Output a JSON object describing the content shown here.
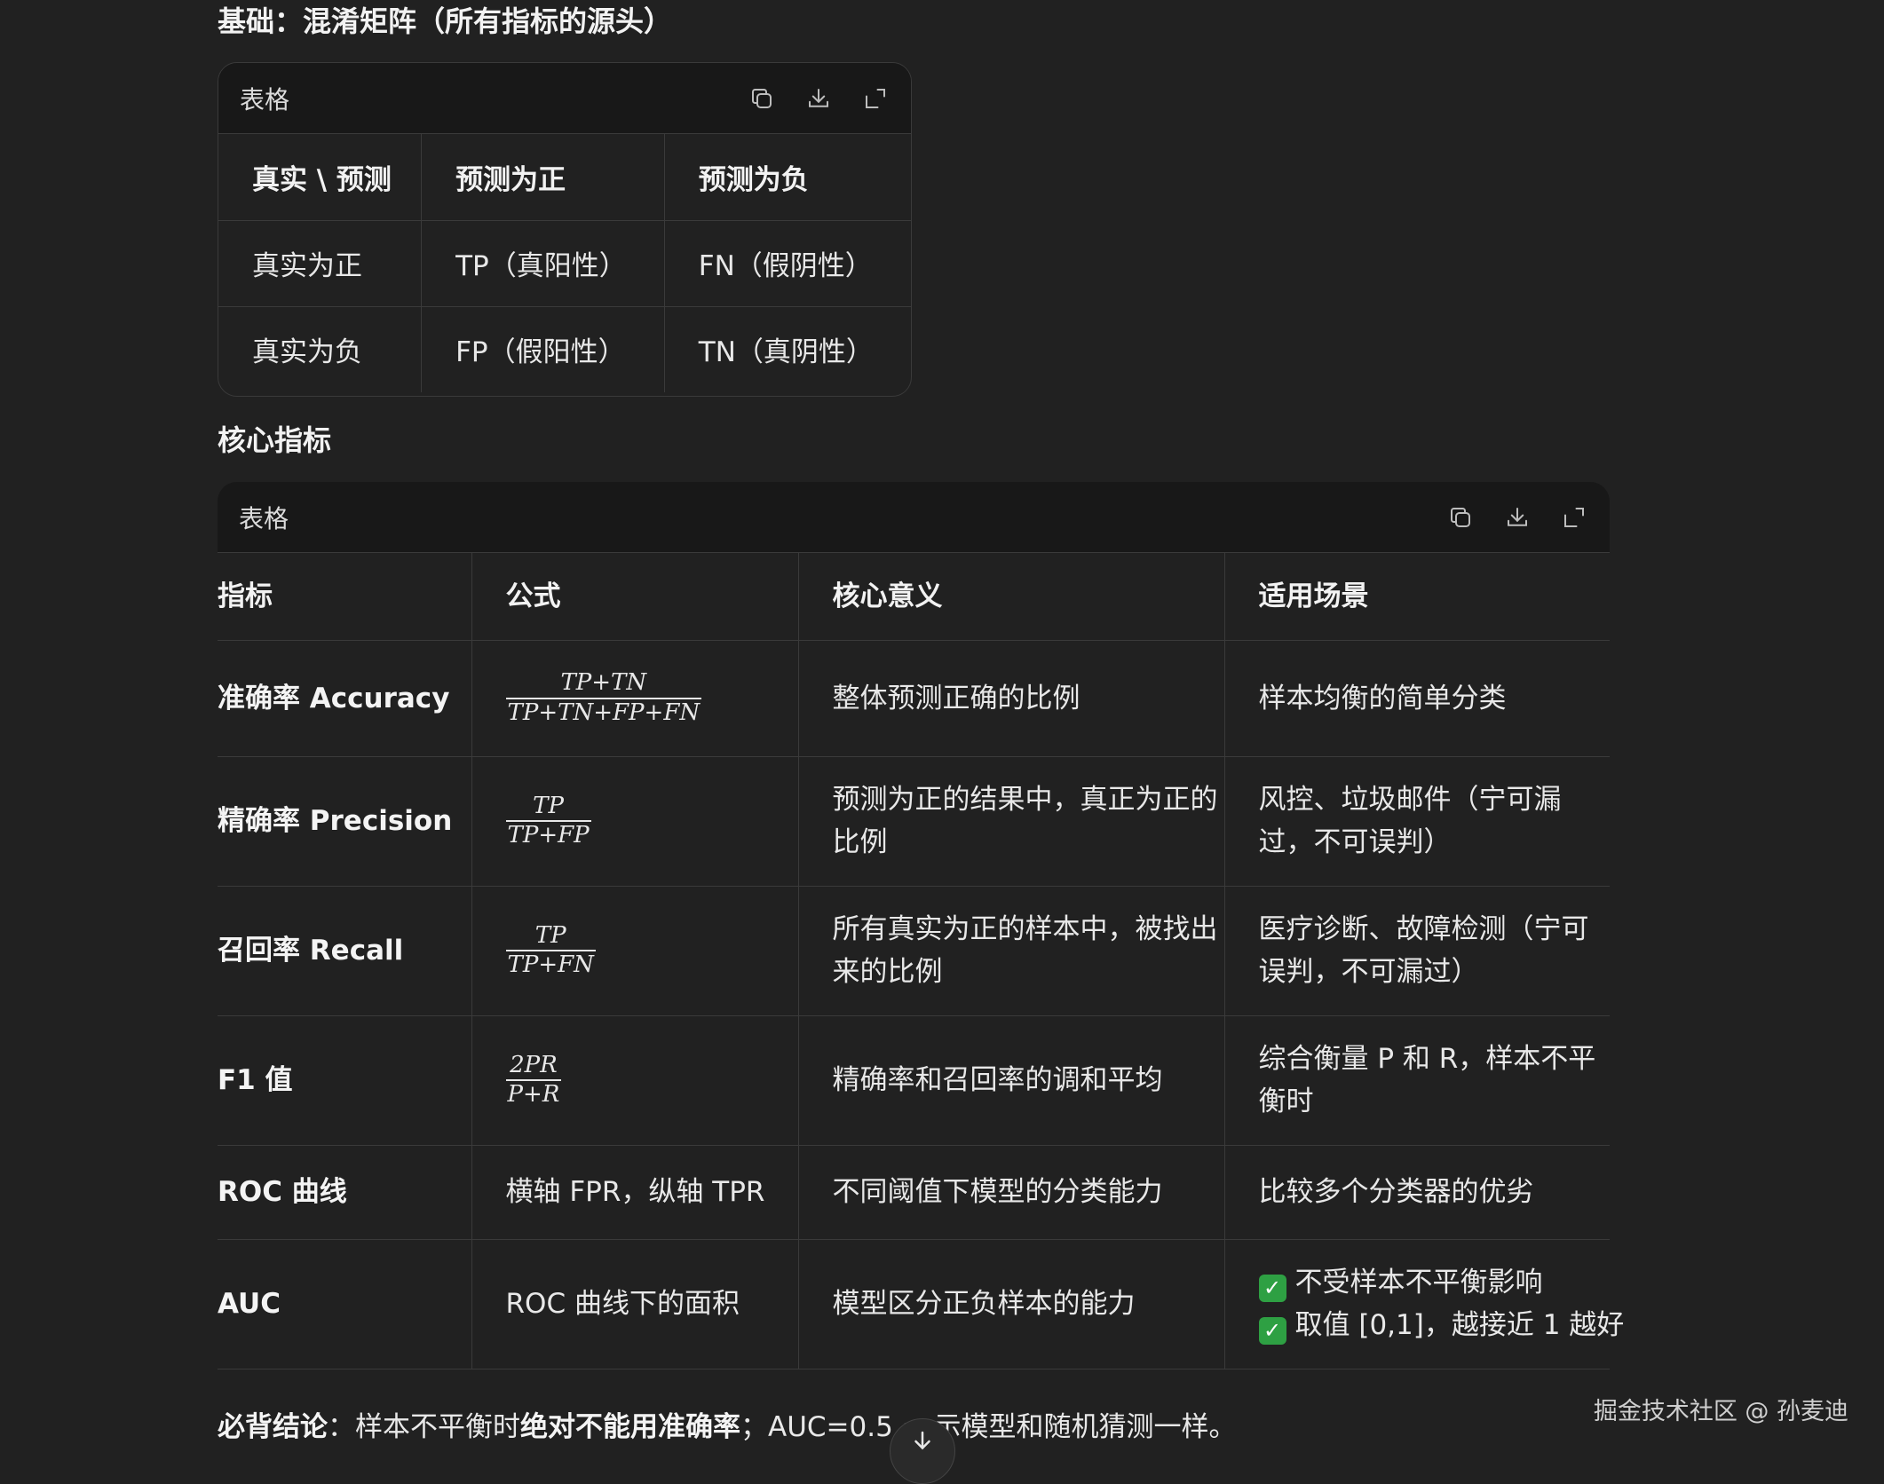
{
  "section1": {
    "heading": "基础：混淆矩阵（所有指标的源头）",
    "card_title": "表格",
    "headers": [
      "真实 \\ 预测",
      "预测为正",
      "预测为负"
    ],
    "rows": [
      [
        "真实为正",
        "TP（真阳性）",
        "FN（假阴性）"
      ],
      [
        "真实为负",
        "FP（假阳性）",
        "TN（真阴性）"
      ]
    ]
  },
  "section2": {
    "heading": "核心指标",
    "card_title": "表格",
    "headers": [
      "指标",
      "公式",
      "核心意义",
      "适用场景"
    ],
    "rows": [
      {
        "metric": "准确率 Accuracy",
        "formula_num": "TP+TN",
        "formula_den": "TP+TN+FP+FN",
        "meaning": "整体预测正确的比例",
        "scenario": "样本均衡的简单分类"
      },
      {
        "metric": "精确率 Precision",
        "formula_num": "TP",
        "formula_den": "TP+FP",
        "meaning": "预测为正的结果中，真正为正的比例",
        "scenario": "风控、垃圾邮件（宁可漏过，不可误判）"
      },
      {
        "metric": "召回率 Recall",
        "formula_num": "TP",
        "formula_den": "TP+FN",
        "meaning": "所有真实为正的样本中，被找出来的比例",
        "scenario": "医疗诊断、故障检测（宁可误判，不可漏过）"
      },
      {
        "metric": "F1 值",
        "formula_num": "2PR",
        "formula_den": "P+R",
        "meaning": "精确率和召回率的调和平均",
        "scenario": "综合衡量 P 和 R，样本不平衡时"
      },
      {
        "metric": "ROC 曲线",
        "formula_text": "横轴 FPR，纵轴 TPR",
        "meaning": "不同阈值下模型的分类能力",
        "scenario": "比较多个分类器的优劣"
      },
      {
        "metric": "AUC",
        "formula_text": "ROC 曲线下的面积",
        "meaning": "模型区分正负样本的能力",
        "scenario_line1": "不受样本不平衡影响",
        "scenario_line2": "取值 [0,1]，越接近 1 越好"
      }
    ]
  },
  "conclusion": {
    "label": "必背结论",
    "sep": "：",
    "part1": "样本不平衡时",
    "bold": "绝对不能用准确率",
    "part2": "；AUC=0.5 = 示模型和随机猜测一样。"
  },
  "watermark": "掘金技术社区 @ 孙麦迪",
  "icons": {
    "copy": "copy-icon",
    "download": "download-icon",
    "expand": "expand-icon",
    "check": "check-box-icon",
    "scroll": "arrow-down-icon"
  }
}
